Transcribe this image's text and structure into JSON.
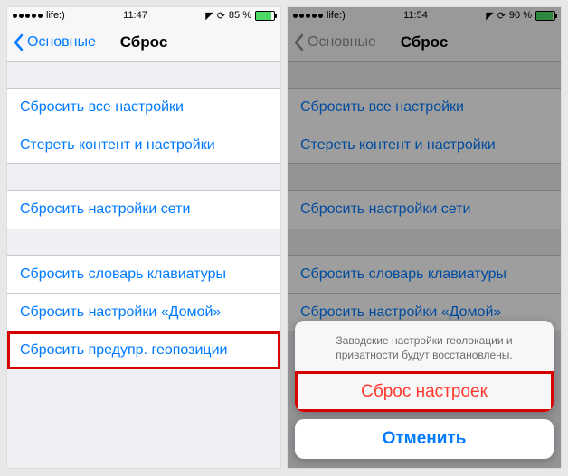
{
  "left": {
    "status": {
      "carrier": "life:)",
      "time": "11:47",
      "battery_pct": "85 %",
      "battery_fill": "85%"
    },
    "nav": {
      "back": "Основные",
      "title": "Сброс"
    },
    "groups": [
      {
        "cells": [
          "Сбросить все настройки",
          "Стереть контент и настройки"
        ]
      },
      {
        "cells": [
          "Сбросить настройки сети"
        ]
      },
      {
        "cells": [
          "Сбросить словарь клавиатуры",
          "Сбросить настройки «Домой»",
          "Сбросить предупр. геопозиции"
        ]
      }
    ]
  },
  "right": {
    "status": {
      "carrier": "life:)",
      "time": "11:54",
      "battery_pct": "90 %",
      "battery_fill": "90%"
    },
    "nav": {
      "back": "Основные",
      "title": "Сброс"
    },
    "groups": [
      {
        "cells": [
          "Сбросить все настройки",
          "Стереть контент и настройки"
        ]
      },
      {
        "cells": [
          "Сбросить настройки сети"
        ]
      },
      {
        "cells": [
          "Сбросить словарь клавиатуры",
          "Сбросить настройки «Домой»"
        ]
      }
    ],
    "sheet": {
      "message": "Заводские настройки геолокации и приватности будут восстановлены.",
      "destructive": "Сброс настроек",
      "cancel": "Отменить"
    }
  }
}
